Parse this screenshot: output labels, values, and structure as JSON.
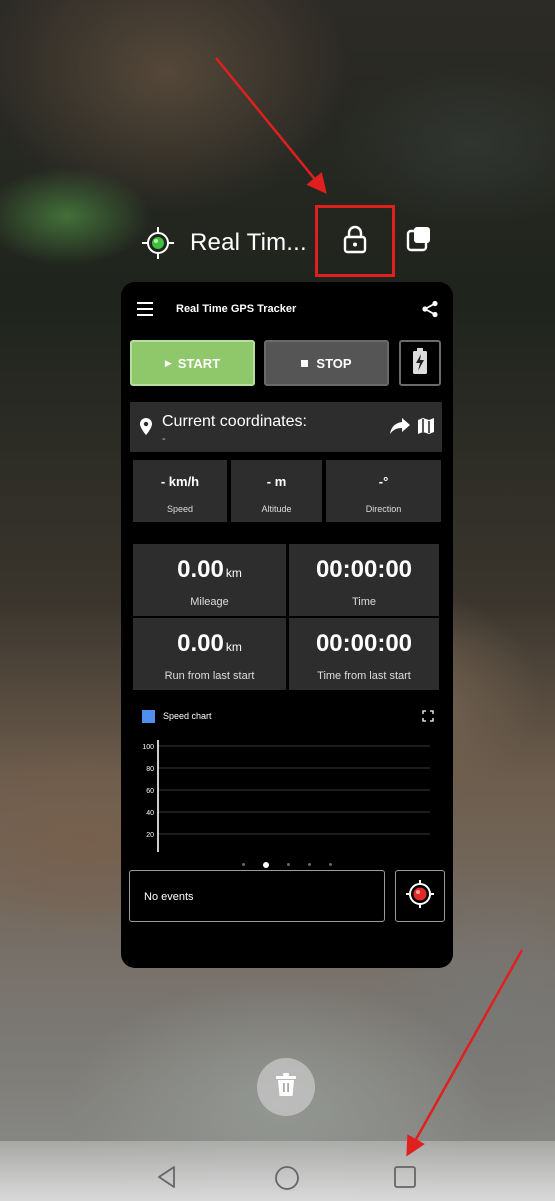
{
  "task": {
    "title": "Real Tim..."
  },
  "app": {
    "title": "Real Time GPS Tracker",
    "buttons": {
      "start": "START",
      "stop": "STOP"
    },
    "coordinates": {
      "label": "Current coordinates:",
      "value": "-"
    },
    "metrics_small": [
      {
        "value": "- km/h",
        "label": "Speed"
      },
      {
        "value": "- m",
        "label": "Altitude"
      },
      {
        "value": "-°",
        "label": "Direction"
      }
    ],
    "metrics_big": [
      {
        "value": "0.00",
        "unit": "km",
        "label": "Mileage"
      },
      {
        "value": "00:00:00",
        "unit": "",
        "label": "Time"
      },
      {
        "value": "0.00",
        "unit": "km",
        "label": "Run from last start"
      },
      {
        "value": "00:00:00",
        "unit": "",
        "label": "Time from last start"
      }
    ],
    "chart": {
      "legend": "Speed chart",
      "y_ticks": [
        "100",
        "80",
        "60",
        "40",
        "20"
      ]
    },
    "pager": {
      "count": 5,
      "active_index": 1
    },
    "events_text": "No events"
  },
  "colors": {
    "start_green": "#8fc76b",
    "stop_gray": "#555555",
    "highlight_red": "#e01f1f",
    "legend_blue": "#4e8ff0"
  },
  "icons": [
    "gps-target-icon",
    "lock-icon",
    "split-screen-icon",
    "menu-icon",
    "share-icon",
    "battery-bolt-icon",
    "location-pin-icon",
    "forward-arrow-icon",
    "map-icon",
    "expand-icon",
    "record-target-icon",
    "trash-icon",
    "back-icon",
    "home-icon",
    "recents-icon"
  ]
}
